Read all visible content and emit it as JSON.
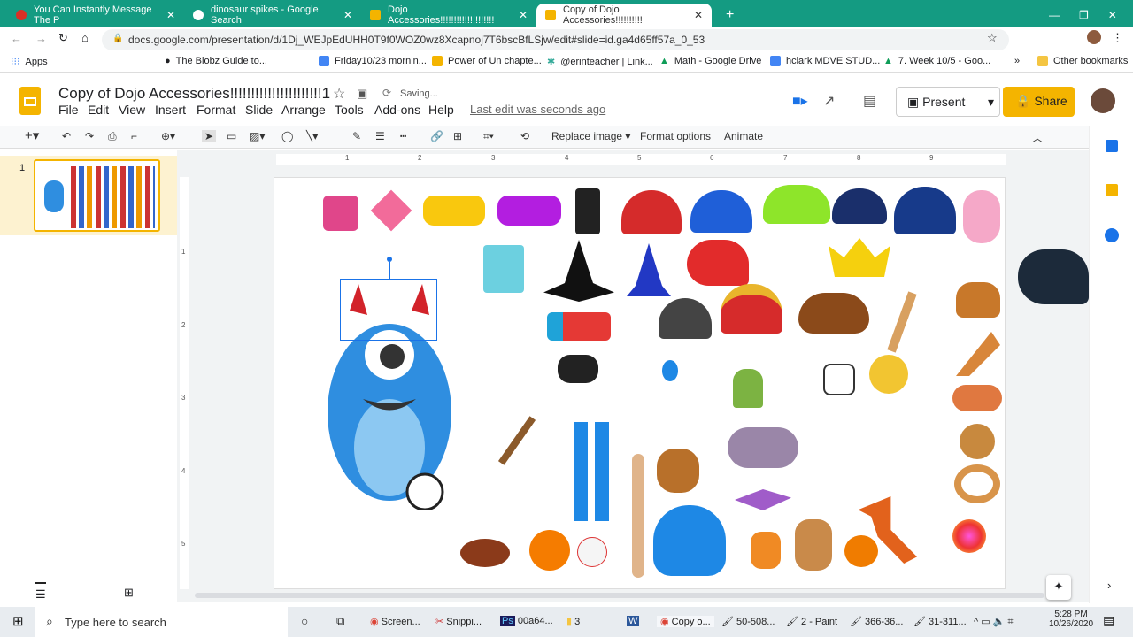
{
  "browser": {
    "tabs": [
      {
        "title": "You Can Instantly Message The P",
        "icon_color": "#d93025"
      },
      {
        "title": "dinosaur spikes - Google Search",
        "icon_color": "#4285f4"
      },
      {
        "title": "Dojo Accessories!!!!!!!!!!!!!!!!!!!!",
        "icon_color": "#f4b400"
      },
      {
        "title": "Copy of Dojo Accessories!!!!!!!!!!",
        "icon_color": "#f4b400",
        "active": true
      }
    ],
    "url": "docs.google.com/presentation/d/1Dj_WEJpEdUHH0T9f0WOZ0wz8Xcapnoj7T6bscBfLSjw/edit#slide=id.ga4d65ff57a_0_53",
    "bookmarks": [
      "Apps",
      "The Blobz Guide to...",
      "Friday10/23 mornin...",
      "Power of Un chapte...",
      "@erinteacher | Link...",
      "Math - Google Drive",
      "hclark MDVE STUD...",
      "7. Week 10/5 - Goo..."
    ],
    "other_bookmarks": "Other bookmarks"
  },
  "doc": {
    "title": "Copy of Dojo Accessories!!!!!!!!!!!!!!!!!!!!!!1",
    "status": "Saving...",
    "menu": [
      "File",
      "Edit",
      "View",
      "Insert",
      "Format",
      "Slide",
      "Arrange",
      "Tools",
      "Add-ons",
      "Help"
    ],
    "last_edit": "Last edit was seconds ago",
    "present": "Present",
    "share": "Share",
    "accent": "#f4b400"
  },
  "toolbar": {
    "replace_image": "Replace image",
    "format_options": "Format options",
    "animate": "Animate"
  },
  "filmstrip": {
    "slide_number": "1"
  },
  "ruler": [
    "1",
    "2",
    "3",
    "4",
    "5",
    "6",
    "7",
    "8",
    "9"
  ],
  "vruler": [
    "1",
    "2",
    "3",
    "4",
    "5"
  ],
  "taskbar": {
    "search": "Type here to search",
    "apps": [
      "Screen...",
      "Snippi...",
      "00a64...",
      "3",
      "Copy o...",
      "50-508...",
      "2 - Paint",
      "366-36...",
      "31-311..."
    ],
    "time": "5:28 PM",
    "date": "10/26/2020"
  }
}
